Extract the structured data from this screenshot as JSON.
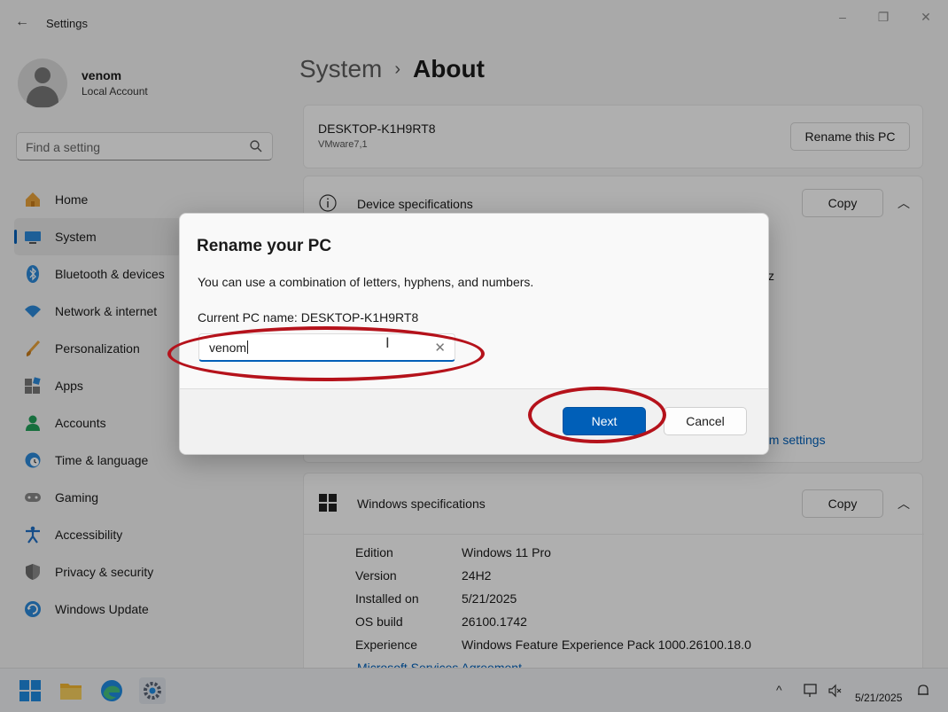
{
  "window": {
    "title": "Settings",
    "back": "←",
    "minimize": "–",
    "restore": "❐",
    "close": "✕"
  },
  "profile": {
    "name": "venom",
    "account_type": "Local Account"
  },
  "search": {
    "placeholder": "Find a setting"
  },
  "nav": [
    {
      "label": "Home",
      "icon": "home-icon"
    },
    {
      "label": "System",
      "icon": "system-icon",
      "active": true
    },
    {
      "label": "Bluetooth & devices",
      "icon": "bluetooth-icon"
    },
    {
      "label": "Network & internet",
      "icon": "wifi-icon"
    },
    {
      "label": "Personalization",
      "icon": "brush-icon"
    },
    {
      "label": "Apps",
      "icon": "apps-icon"
    },
    {
      "label": "Accounts",
      "icon": "accounts-icon"
    },
    {
      "label": "Time & language",
      "icon": "clock-globe-icon"
    },
    {
      "label": "Gaming",
      "icon": "gamepad-icon"
    },
    {
      "label": "Accessibility",
      "icon": "accessibility-icon"
    },
    {
      "label": "Privacy & security",
      "icon": "shield-icon"
    },
    {
      "label": "Windows Update",
      "icon": "update-icon"
    }
  ],
  "breadcrumb": {
    "parent": "System",
    "separator": "›",
    "current": "About"
  },
  "pc_card": {
    "name": "DESKTOP-K1H9RT8",
    "model": "VMware7,1",
    "rename_label": "Rename this PC"
  },
  "device_specs": {
    "title": "Device specifications",
    "copy_label": "Copy",
    "partial_text": "z",
    "link_fragment": "em settings"
  },
  "windows_specs": {
    "title": "Windows specifications",
    "copy_label": "Copy",
    "rows": [
      {
        "key": "Edition",
        "value": "Windows 11 Pro"
      },
      {
        "key": "Version",
        "value": "24H2"
      },
      {
        "key": "Installed on",
        "value": "5/21/2025"
      },
      {
        "key": "OS build",
        "value": "26100.1742"
      },
      {
        "key": "Experience",
        "value": "Windows Feature Experience Pack 1000.26100.18.0"
      }
    ],
    "link": "Microsoft Services Agreement"
  },
  "dialog": {
    "title": "Rename your PC",
    "description": "You can use a combination of letters, hyphens, and numbers.",
    "current_name": "Current PC name: DESKTOP-K1H9RT8",
    "input_value": "venom",
    "clear": "✕",
    "next_label": "Next",
    "cancel_label": "Cancel"
  },
  "taskbar": {
    "date": "5/21/2025",
    "tray_chevron": "^"
  },
  "colors": {
    "accent": "#005fb8",
    "annotation": "#b5121b"
  }
}
